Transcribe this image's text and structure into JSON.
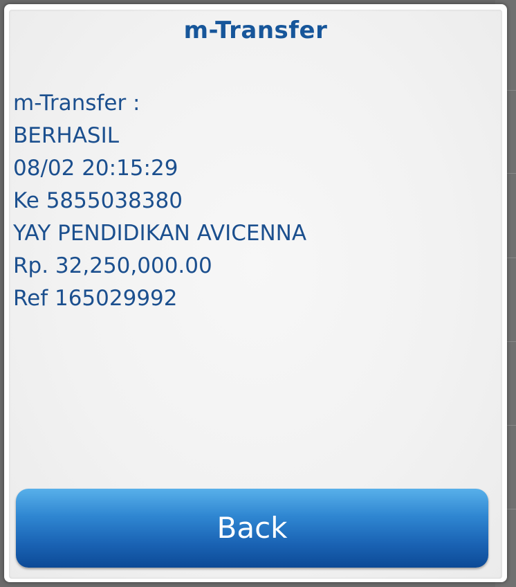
{
  "dialog": {
    "title": "m-Transfer",
    "message_lines": [
      "m-Transfer :",
      "BERHASIL",
      "08/02 20:15:29",
      "Ke 5855038380",
      "YAY PENDIDIKAN AVICENNA",
      "Rp. 32,250,000.00",
      "Ref 165029992"
    ],
    "back_label": "Back"
  },
  "colors": {
    "title_text": "#17569a",
    "message_text": "#1b4f8e",
    "button_top": "#58b0ea",
    "button_bottom": "#0c4a96"
  }
}
